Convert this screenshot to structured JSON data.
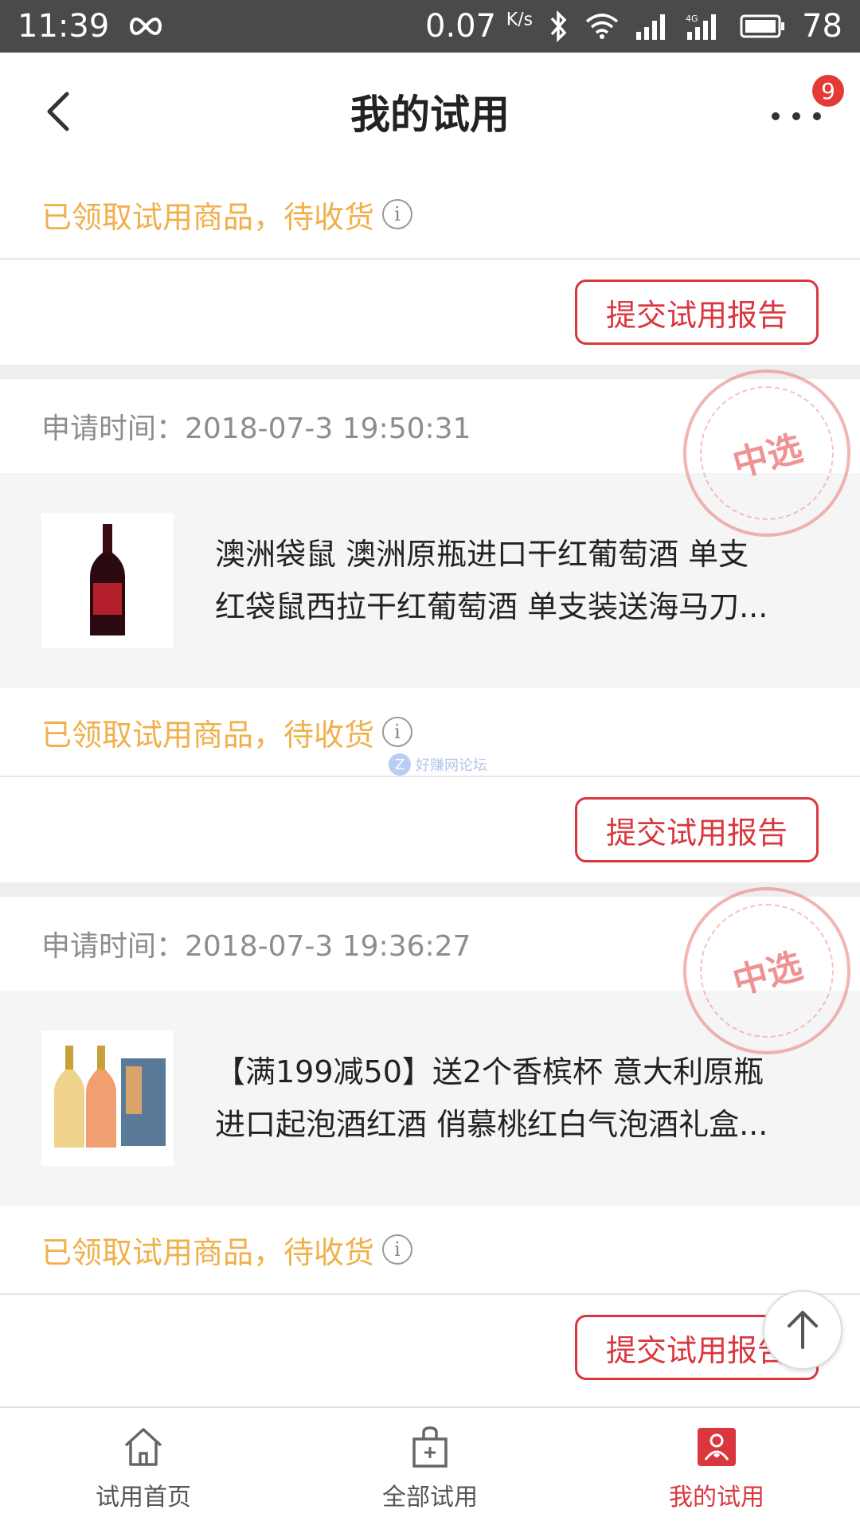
{
  "statusbar": {
    "time": "11:39",
    "speed": "0.07",
    "speed_unit": "K/s",
    "network": "4G",
    "battery": "78"
  },
  "header": {
    "title": "我的试用",
    "badge_count": "9"
  },
  "top_section": {
    "status_text": "已领取试用商品，待收货",
    "report_button": "提交试用报告"
  },
  "cards": [
    {
      "apply_time": "申请时间：2018-07-3 19:50:31",
      "stamp": "中选",
      "goods_title": "澳洲袋鼠 澳洲原瓶进口干红葡萄酒 单支红袋鼠西拉干红葡萄酒 单支装送海马刀...",
      "goods_line1": "澳洲袋鼠 澳洲原瓶进口干红葡萄酒 单支",
      "goods_line2": "红袋鼠西拉干红葡萄酒 单支装送海马刀...",
      "status_text": "已领取试用商品，待收货",
      "report_button": "提交试用报告"
    },
    {
      "apply_time": "申请时间：2018-07-3 19:36:27",
      "stamp": "中选",
      "goods_line1": "【满199减50】送2个香槟杯 意大利原瓶",
      "goods_line2": "进口起泡酒红酒 俏慕桃红白气泡酒礼盒...",
      "status_text": "已领取试用商品，待收货",
      "report_button": "提交试用报告"
    }
  ],
  "watermark": "好赚网论坛",
  "bottom_nav": [
    {
      "label": "试用首页",
      "icon": "home-icon"
    },
    {
      "label": "全部试用",
      "icon": "bag-icon"
    },
    {
      "label": "我的试用",
      "icon": "my-trial-icon"
    }
  ],
  "colors": {
    "accent": "#d9363e",
    "status_text": "#f0b04a"
  }
}
